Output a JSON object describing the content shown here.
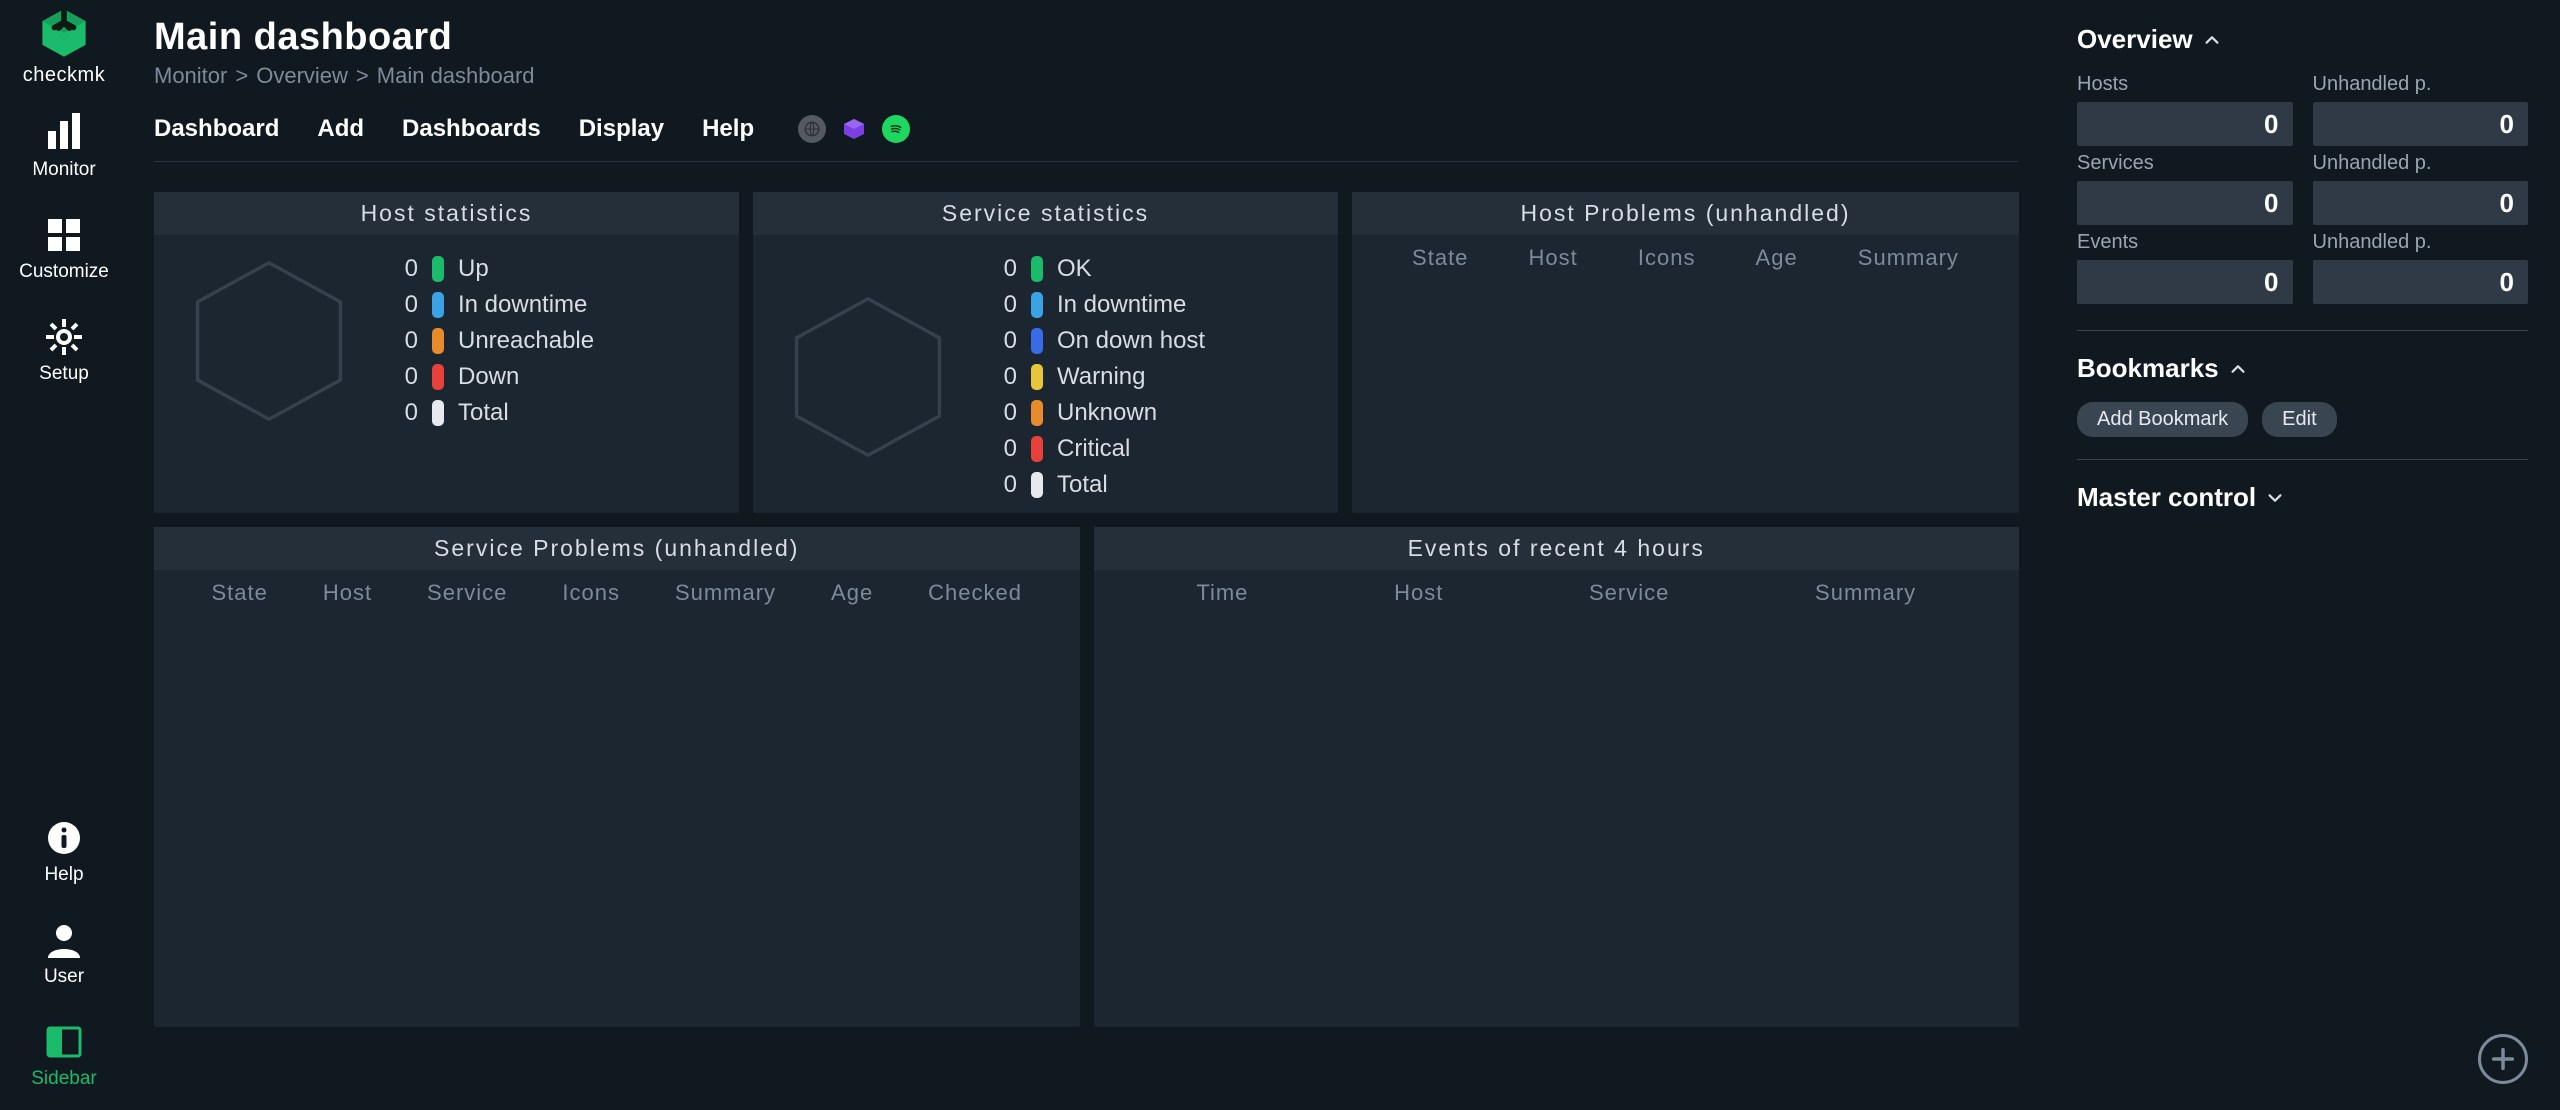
{
  "brand": {
    "name": "checkmk"
  },
  "nav": {
    "top": [
      {
        "id": "monitor",
        "label": "Monitor"
      },
      {
        "id": "customize",
        "label": "Customize"
      },
      {
        "id": "setup",
        "label": "Setup"
      }
    ],
    "bottom": [
      {
        "id": "help",
        "label": "Help"
      },
      {
        "id": "user",
        "label": "User"
      },
      {
        "id": "sidebar",
        "label": "Sidebar",
        "active": true
      }
    ]
  },
  "page": {
    "title": "Main dashboard",
    "breadcrumb": [
      "Monitor",
      "Overview",
      "Main dashboard"
    ]
  },
  "menubar": [
    "Dashboard",
    "Add",
    "Dashboards",
    "Display",
    "Help"
  ],
  "panels": {
    "host_stats": {
      "title": "Host statistics",
      "rows": [
        {
          "value": 0,
          "label": "Up",
          "color": "#1abb6a"
        },
        {
          "value": 0,
          "label": "In downtime",
          "color": "#3aa3e6"
        },
        {
          "value": 0,
          "label": "Unreachable",
          "color": "#e88b2a"
        },
        {
          "value": 0,
          "label": "Down",
          "color": "#e8413a"
        },
        {
          "value": 0,
          "label": "Total",
          "color": "#e6eaef"
        }
      ]
    },
    "service_stats": {
      "title": "Service statistics",
      "rows": [
        {
          "value": 0,
          "label": "OK",
          "color": "#1abb6a"
        },
        {
          "value": 0,
          "label": "In downtime",
          "color": "#3aa3e6"
        },
        {
          "value": 0,
          "label": "On down host",
          "color": "#3a6be6"
        },
        {
          "value": 0,
          "label": "Warning",
          "color": "#e8c63a"
        },
        {
          "value": 0,
          "label": "Unknown",
          "color": "#e88b2a"
        },
        {
          "value": 0,
          "label": "Critical",
          "color": "#e8413a"
        },
        {
          "value": 0,
          "label": "Total",
          "color": "#e6eaef"
        }
      ]
    },
    "host_problems": {
      "title": "Host Problems (unhandled)",
      "columns": [
        "State",
        "Host",
        "Icons",
        "Age",
        "Summary"
      ]
    },
    "service_problems": {
      "title": "Service Problems (unhandled)",
      "columns": [
        "State",
        "Host",
        "Service",
        "Icons",
        "Summary",
        "Age",
        "Checked"
      ]
    },
    "events": {
      "title": "Events of recent 4 hours",
      "columns": [
        "Time",
        "Host",
        "Service",
        "Summary"
      ]
    }
  },
  "right": {
    "overview": {
      "title": "Overview",
      "rows": [
        {
          "l_label": "Hosts",
          "l_value": 0,
          "r_label": "Unhandled p.",
          "r_value": 0
        },
        {
          "l_label": "Services",
          "l_value": 0,
          "r_label": "Unhandled p.",
          "r_value": 0
        },
        {
          "l_label": "Events",
          "l_value": 0,
          "r_label": "Unhandled p.",
          "r_value": 0
        }
      ]
    },
    "bookmarks": {
      "title": "Bookmarks",
      "buttons": [
        "Add Bookmark",
        "Edit"
      ]
    },
    "master_control": {
      "title": "Master control"
    }
  },
  "colors": {
    "accent": "#1abb6a",
    "purple": "#7b3fe4",
    "spotify_green": "#1ed760"
  }
}
